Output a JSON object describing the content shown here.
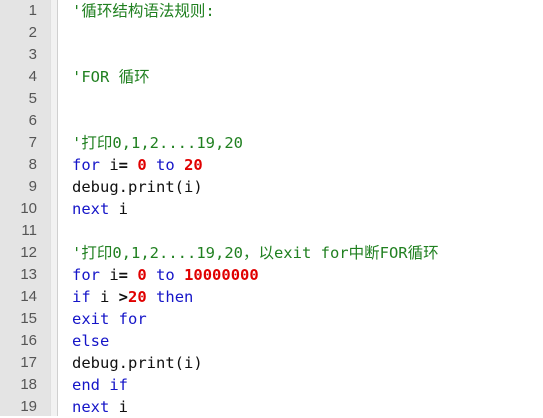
{
  "editor": {
    "lines": [
      {
        "num": "1",
        "tokens": [
          {
            "t": "comment",
            "v": "'循环结构语法规则:"
          }
        ]
      },
      {
        "num": "2",
        "tokens": []
      },
      {
        "num": "3",
        "tokens": []
      },
      {
        "num": "4",
        "tokens": [
          {
            "t": "comment",
            "v": "'FOR 循环"
          }
        ]
      },
      {
        "num": "5",
        "tokens": []
      },
      {
        "num": "6",
        "tokens": []
      },
      {
        "num": "7",
        "tokens": [
          {
            "t": "comment",
            "v": "'打印0,1,2....19,20"
          }
        ]
      },
      {
        "num": "8",
        "tokens": [
          {
            "t": "keyword",
            "v": "for"
          },
          {
            "t": "text",
            "v": " i"
          },
          {
            "t": "op",
            "v": "="
          },
          {
            "t": "text",
            "v": " "
          },
          {
            "t": "number",
            "v": "0"
          },
          {
            "t": "text",
            "v": " "
          },
          {
            "t": "keyword",
            "v": "to"
          },
          {
            "t": "text",
            "v": " "
          },
          {
            "t": "number",
            "v": "20"
          }
        ]
      },
      {
        "num": "9",
        "tokens": [
          {
            "t": "text",
            "v": "debug.print(i)"
          }
        ]
      },
      {
        "num": "10",
        "tokens": [
          {
            "t": "keyword",
            "v": "next"
          },
          {
            "t": "text",
            "v": " i"
          }
        ]
      },
      {
        "num": "11",
        "tokens": []
      },
      {
        "num": "12",
        "tokens": [
          {
            "t": "comment",
            "v": "'打印0,1,2....19,20，以exit for中断FOR循环"
          }
        ]
      },
      {
        "num": "13",
        "tokens": [
          {
            "t": "keyword",
            "v": "for"
          },
          {
            "t": "text",
            "v": " i"
          },
          {
            "t": "op",
            "v": "="
          },
          {
            "t": "text",
            "v": " "
          },
          {
            "t": "number",
            "v": "0"
          },
          {
            "t": "text",
            "v": " "
          },
          {
            "t": "keyword",
            "v": "to"
          },
          {
            "t": "text",
            "v": " "
          },
          {
            "t": "number",
            "v": "10000000"
          }
        ]
      },
      {
        "num": "14",
        "tokens": [
          {
            "t": "keyword",
            "v": "if"
          },
          {
            "t": "text",
            "v": " i "
          },
          {
            "t": "op",
            "v": ">"
          },
          {
            "t": "number",
            "v": "20"
          },
          {
            "t": "text",
            "v": " "
          },
          {
            "t": "keyword",
            "v": "then"
          }
        ]
      },
      {
        "num": "15",
        "tokens": [
          {
            "t": "keyword",
            "v": "exit for"
          }
        ]
      },
      {
        "num": "16",
        "tokens": [
          {
            "t": "keyword",
            "v": "else"
          }
        ]
      },
      {
        "num": "17",
        "tokens": [
          {
            "t": "text",
            "v": "debug.print(i)"
          }
        ]
      },
      {
        "num": "18",
        "tokens": [
          {
            "t": "keyword",
            "v": "end if"
          }
        ]
      },
      {
        "num": "19",
        "tokens": [
          {
            "t": "keyword",
            "v": "next"
          },
          {
            "t": "text",
            "v": " i"
          }
        ]
      }
    ]
  },
  "colors": {
    "comment": "#208020",
    "keyword": "#1515c8",
    "number": "#e00000",
    "text": "#101010",
    "gutter_bg": "#e4e4e4"
  }
}
